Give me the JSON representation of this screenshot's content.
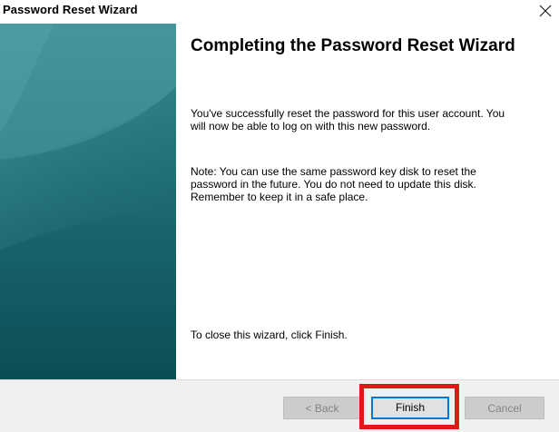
{
  "window": {
    "title": "Password Reset Wizard"
  },
  "icons": {
    "close": "close-icon"
  },
  "colors": {
    "side_panel_top": "#2f7f86",
    "side_panel_bottom": "#0d4f57",
    "highlight": "#e01818",
    "focus_border": "#0078d7"
  },
  "content": {
    "heading": "Completing the Password Reset Wizard",
    "paragraph1": "You've successfully reset the password for this user account. You will now be able to log on with this new password.",
    "paragraph2": "Note: You can use the same password key disk to reset the password in the future. You do not need to update this disk. Remember to keep it in a safe place.",
    "paragraph3": "To close this wizard, click Finish."
  },
  "buttons": {
    "back": "< Back",
    "finish": "Finish",
    "cancel": "Cancel"
  }
}
